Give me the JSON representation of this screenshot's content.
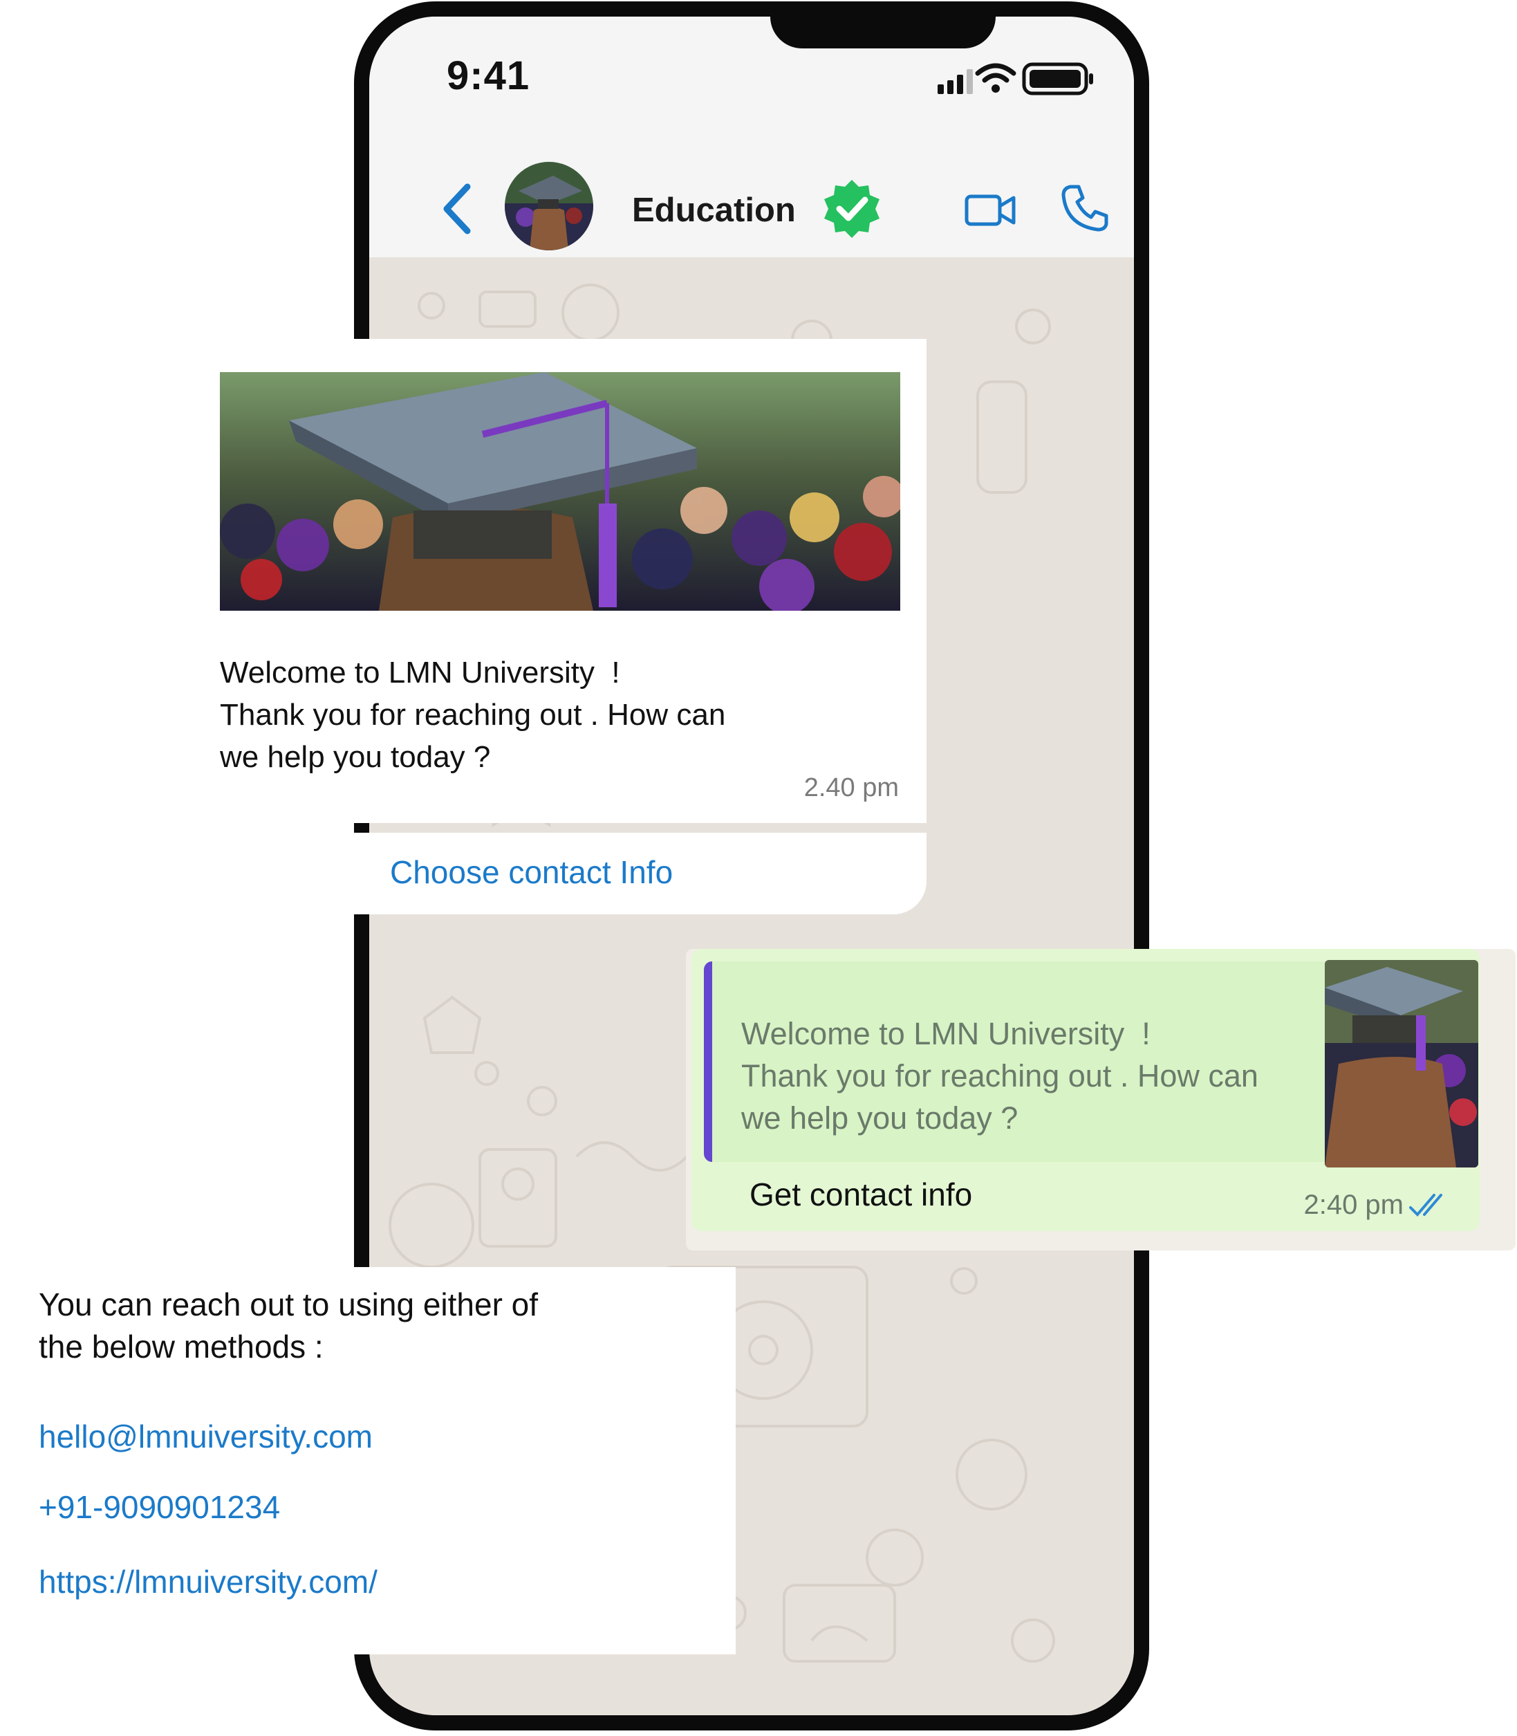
{
  "status_bar": {
    "time": "9:41"
  },
  "header": {
    "title": "Education"
  },
  "incoming_message": {
    "lines": [
      "Welcome to LMN University  !",
      "Thank you for reaching out . How can",
      "we help you today ?"
    ],
    "time": "2.40 pm",
    "button_label": "Choose contact Info"
  },
  "reply": {
    "quoted_lines": [
      "Welcome to LMN University  !",
      "Thank you for reaching out . How can",
      "we help you today ?"
    ],
    "text": "Get contact info",
    "time": "2:40 pm"
  },
  "contact_info": {
    "lines": [
      "You can reach out to using either of",
      "the below methods :"
    ],
    "email": "hello@lmnuiversity.com",
    "phone": "+91-9090901234",
    "website": "https://lmnuiversity.com/"
  },
  "colors": {
    "link": "#1b7ac9",
    "verified": "#25c05f",
    "reply_bubble": "#e3f7d3",
    "quote_bar": "#6446d0",
    "chat_wallpaper": "#e7e1db"
  },
  "icons": [
    "back-chevron-icon",
    "verified-badge-icon",
    "video-call-icon",
    "phone-call-icon",
    "signal-icon",
    "wifi-icon",
    "battery-icon",
    "double-check-icon"
  ]
}
